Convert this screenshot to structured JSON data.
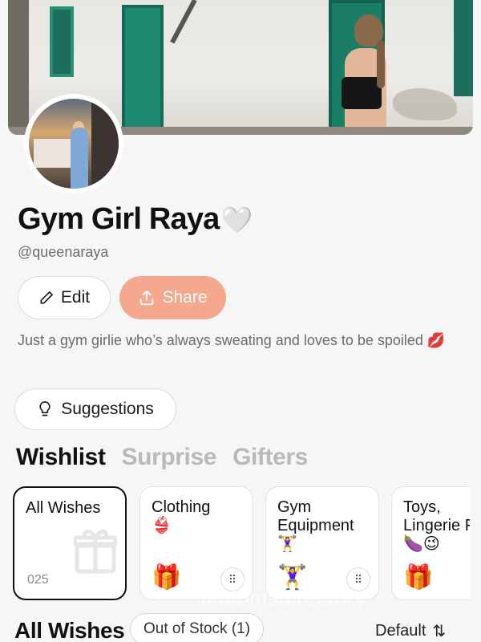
{
  "profile": {
    "name": "Gym Girl Raya",
    "name_emoji": "🤍",
    "handle": "@queenaraya",
    "bio": "Just a gym girlie who’s always sweating and loves to be spoiled 💋"
  },
  "actions": {
    "edit_label": "Edit",
    "share_label": "Share",
    "suggestions_label": "Suggestions"
  },
  "tabs": [
    {
      "label": "Wishlist",
      "active": true
    },
    {
      "label": "Surprise",
      "active": false
    },
    {
      "label": "Gifters",
      "active": false
    }
  ],
  "categories": [
    {
      "title": "All Wishes",
      "count": "025"
    },
    {
      "title": "Clothing",
      "emoji": "👙",
      "icon": "🎁"
    },
    {
      "title": "Gym Equipment",
      "emoji": "🏋️‍♀️",
      "icon": "🏋️‍♀️"
    },
    {
      "title": "Toys, Lingerie Fun🍆😉",
      "icon": "🎁"
    }
  ],
  "list": {
    "title": "All Wishes",
    "filter_label": "Out of Stock (1)",
    "sort_label": "Default",
    "sort_icon": "⇅"
  },
  "watermark": "findomsdirectory"
}
